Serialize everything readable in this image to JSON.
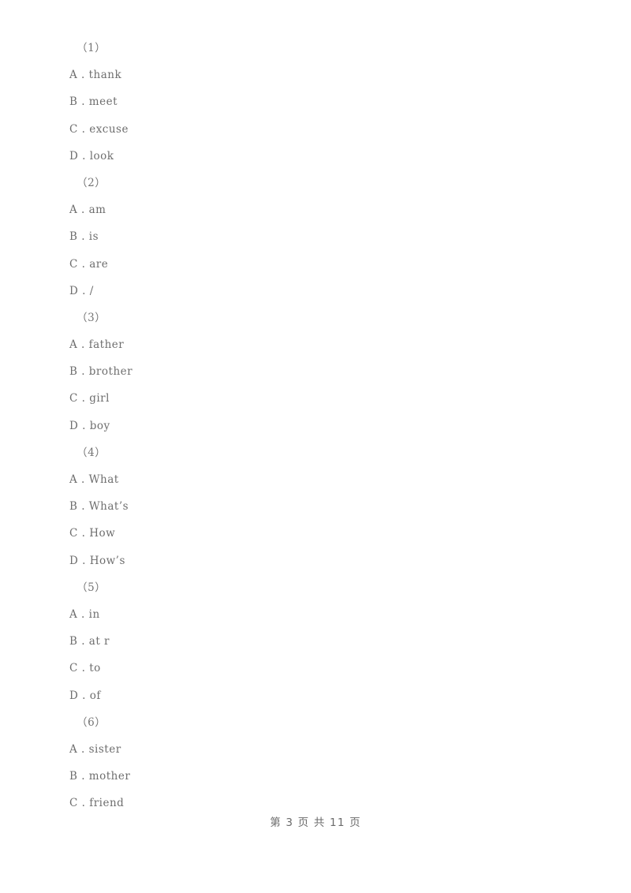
{
  "document": {
    "page_background": "#ffffff",
    "text_color": "#6e6e6e",
    "questions": [
      {
        "number": "（1）",
        "options": [
          "A . thank",
          "B . meet",
          "C . excuse",
          "D . look"
        ]
      },
      {
        "number": "（2）",
        "options": [
          "A . am",
          "B . is",
          "C . are",
          "D . /"
        ]
      },
      {
        "number": "（3）",
        "options": [
          "A . father",
          "B . brother",
          "C . girl",
          "D . boy"
        ]
      },
      {
        "number": "（4）",
        "options": [
          "A . What",
          "B . What’s",
          "C . How",
          "D . How’s"
        ]
      },
      {
        "number": "（5）",
        "options": [
          "A . in",
          "B . at r",
          "C . to",
          "D . of"
        ]
      },
      {
        "number": "（6）",
        "options": [
          "A . sister",
          "B . mother",
          "C . friend"
        ]
      }
    ]
  },
  "footer": {
    "page_label": "第 3 页 共 11 页"
  }
}
